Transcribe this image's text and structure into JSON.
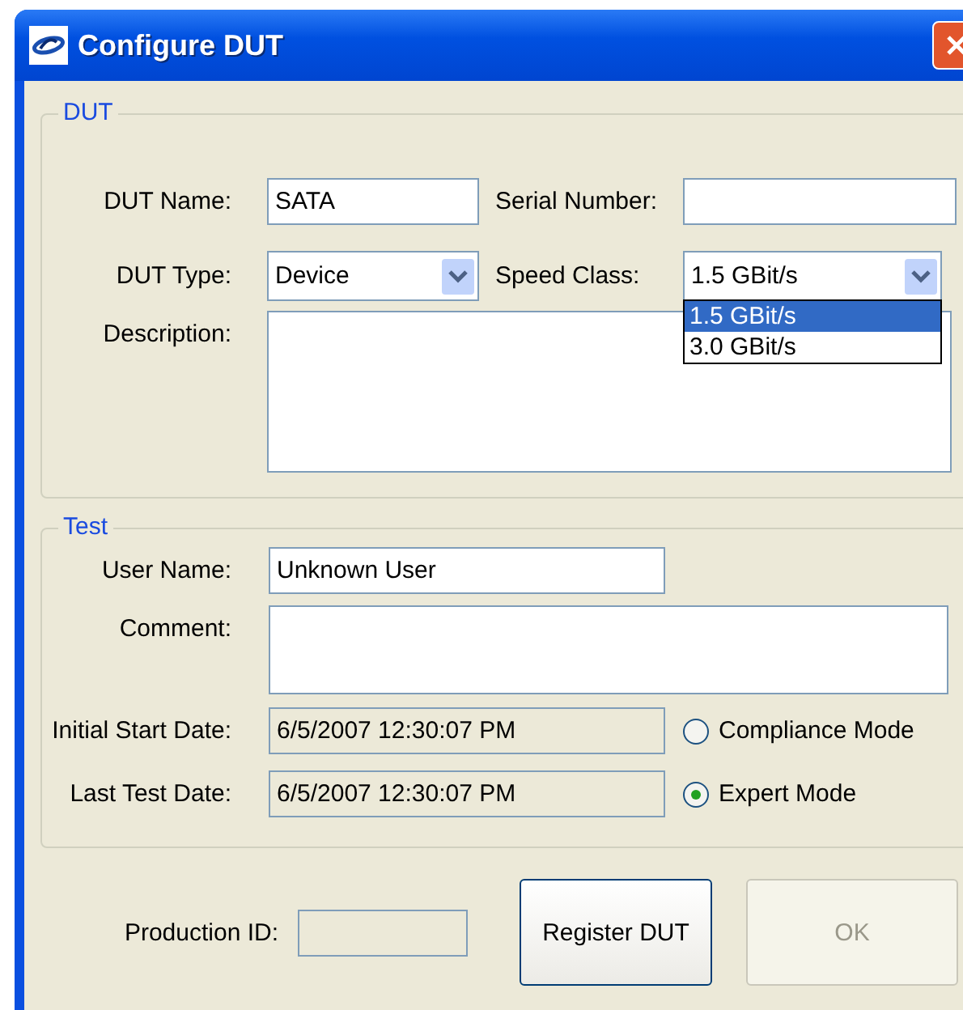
{
  "window": {
    "title": "Configure DUT"
  },
  "dut": {
    "legend": "DUT",
    "name": {
      "label": "DUT Name:",
      "value": "SATA"
    },
    "serial": {
      "label": "Serial Number:"
    },
    "type": {
      "label": "DUT Type:",
      "value": "Device"
    },
    "speed": {
      "label": "Speed Class:",
      "value": "1.5 GBit/s",
      "expanded": true,
      "options": [
        {
          "label": "1.5 GBit/s",
          "selected": true
        },
        {
          "label": "3.0 GBit/s",
          "selected": false
        }
      ]
    },
    "description": {
      "label": "Description:"
    }
  },
  "test": {
    "legend": "Test",
    "user": {
      "label": "User Name:",
      "value": "Unknown User"
    },
    "comment": {
      "label": "Comment:"
    },
    "start": {
      "label": "Initial Start Date:",
      "value": "6/5/2007 12:30:07 PM"
    },
    "last": {
      "label": "Last Test Date:",
      "value": "6/5/2007 12:30:07 PM"
    },
    "modes": [
      {
        "label": "Compliance Mode",
        "selected": false
      },
      {
        "label": "Expert Mode",
        "selected": true
      }
    ]
  },
  "production": {
    "label": "Production ID:"
  },
  "buttons": [
    {
      "label": "Register DUT",
      "disabled": false
    },
    {
      "label": "OK",
      "disabled": true
    }
  ]
}
